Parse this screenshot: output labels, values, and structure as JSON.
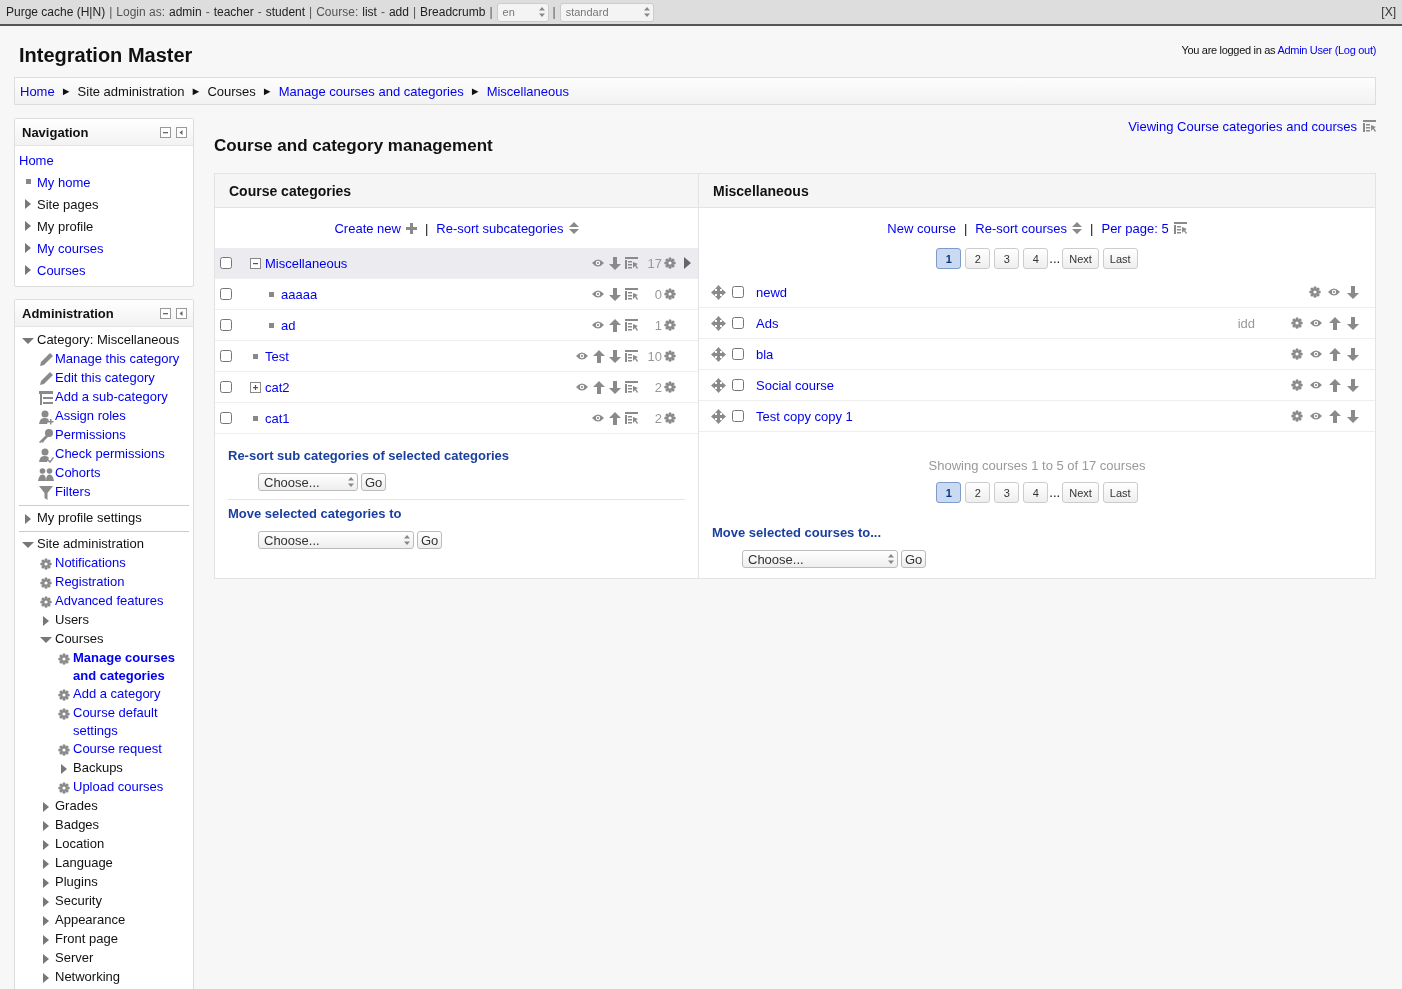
{
  "top_bar": {
    "items": [
      {
        "text": "Purge cache (H|N)",
        "kind": "link"
      },
      {
        "text": "|",
        "kind": "sep"
      },
      {
        "text": "Login as:",
        "kind": "label"
      },
      {
        "text": "admin",
        "kind": "link"
      },
      {
        "text": "-",
        "kind": "label"
      },
      {
        "text": "teacher",
        "kind": "link"
      },
      {
        "text": "-",
        "kind": "label"
      },
      {
        "text": "student",
        "kind": "link"
      },
      {
        "text": "|",
        "kind": "sep"
      },
      {
        "text": "Course:",
        "kind": "label"
      },
      {
        "text": "list",
        "kind": "link"
      },
      {
        "text": "-",
        "kind": "label"
      },
      {
        "text": "add",
        "kind": "link"
      },
      {
        "text": "|",
        "kind": "sep"
      },
      {
        "text": "Breadcrumb",
        "kind": "link"
      },
      {
        "text": "|",
        "kind": "sep"
      },
      {
        "text": "en",
        "kind": "select"
      },
      {
        "text": "|",
        "kind": "sep"
      },
      {
        "text": "standard",
        "kind": "select"
      }
    ],
    "close": "[X]"
  },
  "header": {
    "site_name": "Integration Master",
    "login_prefix": "You are logged in as",
    "user": "Admin User",
    "logout": "(Log out)"
  },
  "breadcrumb": [
    {
      "label": "Home",
      "link": true
    },
    {
      "label": "Site administration",
      "link": false
    },
    {
      "label": "Courses",
      "link": false
    },
    {
      "label": "Manage courses and categories",
      "link": true
    },
    {
      "label": "Miscellaneous",
      "link": true
    }
  ],
  "breadcrumb_separator": "►",
  "navigation": {
    "title": "Navigation",
    "items": [
      {
        "label": "Home",
        "link": true,
        "kind": "root"
      },
      {
        "label": "My home",
        "link": true,
        "kind": "leaf"
      },
      {
        "label": "Site pages",
        "link": false,
        "kind": "branch",
        "expanded": false
      },
      {
        "label": "My profile",
        "link": false,
        "kind": "branch",
        "expanded": false
      },
      {
        "label": "My courses",
        "link": true,
        "kind": "branch",
        "expanded": false
      },
      {
        "label": "Courses",
        "link": true,
        "kind": "branch",
        "expanded": false
      }
    ]
  },
  "administration": {
    "title": "Administration",
    "items": [
      {
        "label": "Category: Miscellaneous",
        "link": false,
        "kind": "branch",
        "expanded": true,
        "children": [
          {
            "label": "Manage this category",
            "link": true,
            "kind": "edit"
          },
          {
            "label": "Edit this category",
            "link": true,
            "kind": "edit"
          },
          {
            "label": "Add a sub-category",
            "link": true,
            "kind": "add"
          },
          {
            "label": "Assign roles",
            "link": true,
            "kind": "roles"
          },
          {
            "label": "Permissions",
            "link": true,
            "kind": "permissions"
          },
          {
            "label": "Check permissions",
            "link": true,
            "kind": "check"
          },
          {
            "label": "Cohorts",
            "link": true,
            "kind": "cohorts"
          },
          {
            "label": "Filters",
            "link": true,
            "kind": "filters"
          }
        ]
      },
      {
        "label": "My profile settings",
        "link": false,
        "kind": "branch",
        "expanded": false
      },
      {
        "label": "Site administration",
        "link": false,
        "kind": "branch",
        "expanded": true,
        "children": [
          {
            "label": "Notifications",
            "link": true,
            "kind": "setting"
          },
          {
            "label": "Registration",
            "link": true,
            "kind": "setting"
          },
          {
            "label": "Advanced features",
            "link": true,
            "kind": "setting"
          },
          {
            "label": "Users",
            "link": false,
            "kind": "branch",
            "expanded": false
          },
          {
            "label": "Courses",
            "link": false,
            "kind": "branch",
            "expanded": true,
            "children": [
              {
                "label": "Manage courses and categories",
                "link": true,
                "kind": "setting",
                "current": true
              },
              {
                "label": "Add a category",
                "link": true,
                "kind": "setting"
              },
              {
                "label": "Course default settings",
                "link": true,
                "kind": "setting"
              },
              {
                "label": "Course request",
                "link": true,
                "kind": "setting"
              },
              {
                "label": "Backups",
                "link": false,
                "kind": "branch",
                "expanded": false
              },
              {
                "label": "Upload courses",
                "link": true,
                "kind": "setting"
              }
            ]
          },
          {
            "label": "Grades",
            "link": false,
            "kind": "branch",
            "expanded": false
          },
          {
            "label": "Badges",
            "link": false,
            "kind": "branch",
            "expanded": false
          },
          {
            "label": "Location",
            "link": false,
            "kind": "branch",
            "expanded": false
          },
          {
            "label": "Language",
            "link": false,
            "kind": "branch",
            "expanded": false
          },
          {
            "label": "Plugins",
            "link": false,
            "kind": "branch",
            "expanded": false
          },
          {
            "label": "Security",
            "link": false,
            "kind": "branch",
            "expanded": false
          },
          {
            "label": "Appearance",
            "link": false,
            "kind": "branch",
            "expanded": false
          },
          {
            "label": "Front page",
            "link": false,
            "kind": "branch",
            "expanded": false
          },
          {
            "label": "Server",
            "link": false,
            "kind": "branch",
            "expanded": false
          },
          {
            "label": "Networking",
            "link": false,
            "kind": "branch",
            "expanded": false
          }
        ]
      }
    ]
  },
  "view_link": "Viewing Course categories and courses",
  "page_title": "Course and category management",
  "categories": {
    "heading": "Course categories",
    "actions": [
      {
        "label": "Create new",
        "kind": "create"
      },
      {
        "label": "Re-sort subcategories",
        "kind": "sort"
      }
    ],
    "action_separator": "|",
    "rows": [
      {
        "name": "Miscellaneous",
        "checked": false,
        "selected": true,
        "expanded": true,
        "move_up": false,
        "move_down": true,
        "count": "17",
        "children": [
          {
            "name": "aaaaa",
            "checked": false,
            "selected": false,
            "move_up": false,
            "move_down": true,
            "count": "0"
          },
          {
            "name": "ad",
            "checked": false,
            "selected": false,
            "move_up": true,
            "move_down": false,
            "count": "1"
          }
        ]
      },
      {
        "name": "Test",
        "checked": false,
        "selected": false,
        "move_up": true,
        "move_down": true,
        "count": "10"
      },
      {
        "name": "cat2",
        "checked": false,
        "selected": false,
        "expanded": false,
        "move_up": true,
        "move_down": true,
        "count": "2"
      },
      {
        "name": "cat1",
        "checked": false,
        "selected": false,
        "move_up": true,
        "move_down": false,
        "count": "2"
      }
    ],
    "bulk": [
      {
        "title": "Re-sort sub categories of selected categories",
        "select": "Choose...",
        "button": "Go"
      },
      {
        "title": "Move selected categories to",
        "select": "Choose...",
        "button": "Go"
      }
    ]
  },
  "courses": {
    "heading": "Miscellaneous",
    "actions": [
      {
        "label": "New course",
        "kind": "plain"
      },
      {
        "label": "Re-sort courses",
        "kind": "sort"
      },
      {
        "label": "Per page: 5",
        "kind": "perpage"
      }
    ],
    "action_separator": "|",
    "pagination": [
      {
        "label": "1",
        "kind": "page",
        "selected": true
      },
      {
        "label": "2",
        "kind": "page",
        "selected": false
      },
      {
        "label": "3",
        "kind": "page",
        "selected": false
      },
      {
        "label": "4",
        "kind": "page",
        "selected": false
      },
      {
        "label": "...",
        "kind": "gap"
      },
      {
        "label": "Next",
        "kind": "page",
        "selected": false
      },
      {
        "label": "Last",
        "kind": "page",
        "selected": false
      }
    ],
    "rows": [
      {
        "name": "newd",
        "checked": false,
        "move_up": false,
        "move_down": true
      },
      {
        "name": "Ads",
        "idnumber": "idd",
        "checked": false,
        "move_up": true,
        "move_down": true
      },
      {
        "name": "bla",
        "checked": false,
        "move_up": true,
        "move_down": true
      },
      {
        "name": "Social course",
        "checked": false,
        "move_up": true,
        "move_down": true
      },
      {
        "name": "Test copy copy 1",
        "checked": false,
        "move_up": true,
        "move_down": true
      }
    ],
    "showing": "Showing courses 1 to 5 of 17 courses",
    "pagination_bottom": [
      {
        "label": "1",
        "kind": "page",
        "selected": true
      },
      {
        "label": "2",
        "kind": "page",
        "selected": false
      },
      {
        "label": "3",
        "kind": "page",
        "selected": false
      },
      {
        "label": "4",
        "kind": "page",
        "selected": false
      },
      {
        "label": "...",
        "kind": "gap"
      },
      {
        "label": "Next",
        "kind": "page",
        "selected": false
      },
      {
        "label": "Last",
        "kind": "page",
        "selected": false
      }
    ],
    "bulk": [
      {
        "title": "Move selected courses to...",
        "select": "Choose...",
        "button": "Go"
      }
    ]
  }
}
